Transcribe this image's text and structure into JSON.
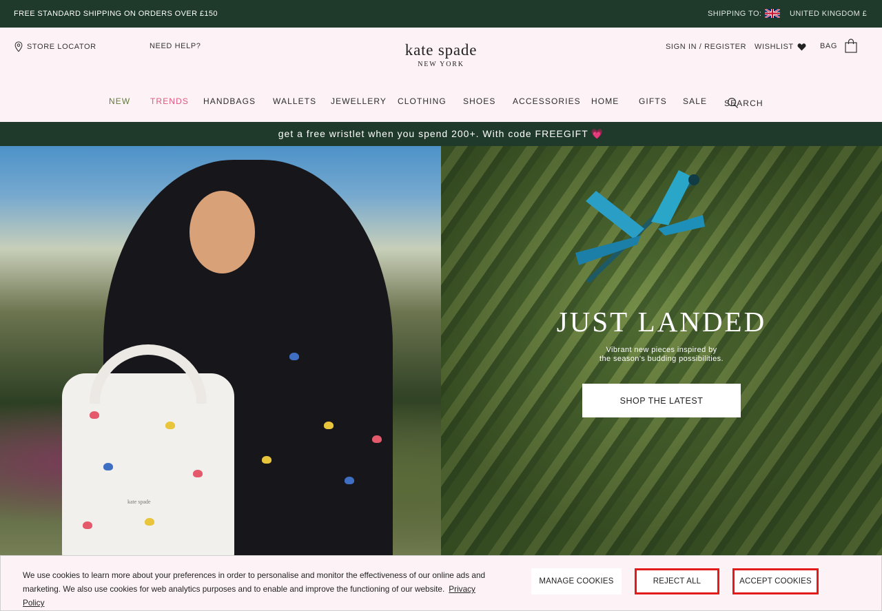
{
  "topbar": {
    "promo": "FREE STANDARD SHIPPING ON ORDERS OVER £150",
    "shipping_label": "SHIPPING TO:",
    "country": "UNITED KINGDOM £",
    "flag_icon": "uk-flag-icon"
  },
  "header": {
    "store_locator": "STORE LOCATOR",
    "need_help": "NEED HELP?",
    "sign_in": "SIGN IN / REGISTER",
    "wishlist": "WISHLIST",
    "bag": "BAG",
    "logo_line1": "kate spade",
    "logo_line2": "NEW YORK"
  },
  "nav": {
    "items": [
      "NEW",
      "TRENDS",
      "HANDBAGS",
      "WALLETS",
      "JEWELLERY",
      "CLOTHING",
      "SHOES",
      "ACCESSORIES",
      "HOME",
      "GIFTS",
      "SALE"
    ],
    "search": "SEARCH"
  },
  "promo_bar": {
    "text": "get a free wristlet when you spend 200+. With code FREEGIFT",
    "emoji": "💗"
  },
  "hero": {
    "title": "JUST LANDED",
    "subtitle_line1": "Vibrant new pieces inspired by",
    "subtitle_line2": "the season's budding possibilities.",
    "cta": "SHOP THE LATEST",
    "bag_logo": "kate spade"
  },
  "cookie": {
    "text": "We use cookies to learn more about your preferences in order to personalise and monitor the effectiveness of our online ads and marketing. We also use cookies for web analytics purposes and to enable and improve the functioning of our website.",
    "policy_link": "Privacy Policy",
    "manage": "MANAGE COOKIES",
    "reject": "REJECT ALL",
    "accept": "ACCEPT COOKIES"
  },
  "colors": {
    "dark_green": "#1f3a2b",
    "pink_bg": "#fdf3f6",
    "pink_accent": "#e0557c",
    "new_green": "#5f7a35",
    "highlight_red": "#e21a1a"
  }
}
